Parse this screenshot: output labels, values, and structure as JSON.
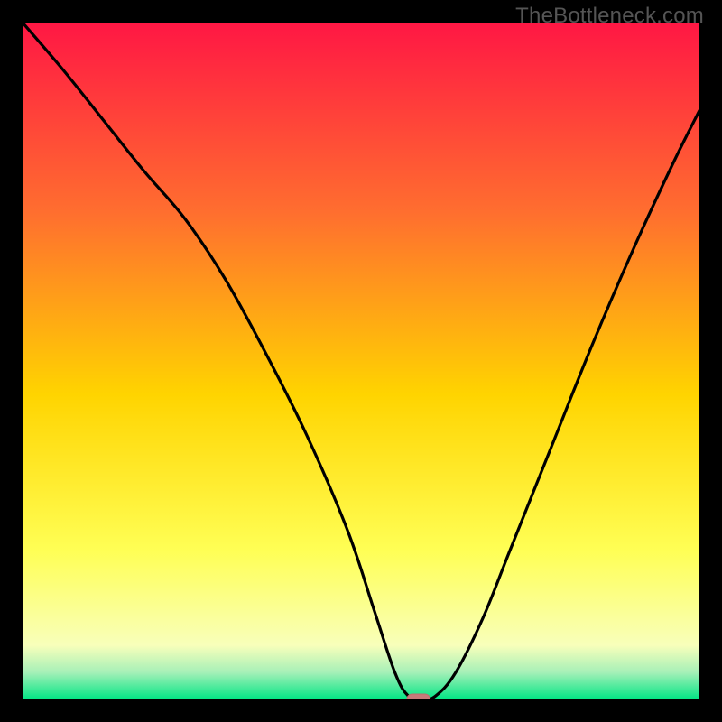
{
  "watermark": "TheBottleneck.com",
  "colors": {
    "frame": "#000000",
    "watermark": "#555555",
    "curve": "#000000",
    "marker_fill": "#c77a7a",
    "marker_stroke": "#bb6e6e",
    "gradient_top": "#ff1744",
    "gradient_mid_upper": "#ff6e2f",
    "gradient_mid": "#ffd400",
    "gradient_mid_lower": "#ffff55",
    "gradient_lower": "#f8ffba",
    "gradient_bottom_strip_top": "#a6f0b8",
    "gradient_bottom": "#00e584"
  },
  "chart_data": {
    "type": "line",
    "title": "",
    "xlabel": "",
    "ylabel": "",
    "xlim": [
      0,
      100
    ],
    "ylim": [
      0,
      100
    ],
    "series": [
      {
        "name": "bottleneck-curve",
        "x": [
          0,
          6,
          12,
          18,
          24,
          30,
          36,
          42,
          48,
          52,
          55,
          57,
          59,
          61,
          64,
          68,
          72,
          78,
          84,
          90,
          96,
          100
        ],
        "y": [
          100,
          93,
          85.5,
          78,
          71,
          62,
          51,
          39,
          25,
          13,
          4,
          0.5,
          0,
          0.5,
          4,
          12,
          22,
          37,
          52,
          66,
          79,
          87
        ]
      }
    ],
    "marker": {
      "x": 58.5,
      "y": 0
    },
    "annotations": []
  }
}
